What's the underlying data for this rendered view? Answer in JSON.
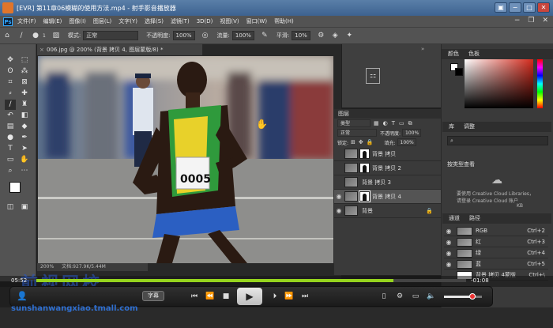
{
  "window": {
    "title": "[EVR] 第11章06模糊的使用方法.mp4 - 射手影音播放器"
  },
  "menubar": {
    "logo": "Ps",
    "items": [
      "文件(F)",
      "编辑(E)",
      "图像(I)",
      "图层(L)",
      "文字(Y)",
      "选择(S)",
      "滤镜(T)",
      "3D(D)",
      "视图(V)",
      "窗口(W)",
      "帮助(H)"
    ]
  },
  "optbar": {
    "brush_size": "1",
    "mode_label": "模式:",
    "mode_value": "正常",
    "opacity_label": "不透明度:",
    "opacity_value": "100%",
    "flow_label": "流量:",
    "flow_value": "100%",
    "smooth_label": "平滑:",
    "smooth_value": "10%"
  },
  "document": {
    "tab_title": "006.jpg @ 200% (背景 拷贝 4, 图层蒙版/8) *",
    "zoom": "200%",
    "docinfo": "文档:927.9K/5.44M"
  },
  "layers_panel": {
    "title": "图层",
    "kind_label": "类型",
    "blend_mode": "正常",
    "opacity_label": "不透明度:",
    "opacity_value": "100%",
    "lock_label": "锁定:",
    "fill_label": "填充:",
    "fill_value": "100%",
    "layers": [
      {
        "name": "背景 拷贝",
        "visible": false,
        "mask": true,
        "selected": false
      },
      {
        "name": "背景 拷贝 2",
        "visible": false,
        "mask": true,
        "selected": false
      },
      {
        "name": "背景 拷贝 3",
        "visible": false,
        "mask": false,
        "selected": false
      },
      {
        "name": "背景 拷贝 4",
        "visible": true,
        "mask": true,
        "selected": true
      },
      {
        "name": "背景",
        "visible": true,
        "mask": false,
        "selected": false
      }
    ]
  },
  "right_panels": {
    "color_tab": "颜色",
    "swatches_tab": "色板",
    "library_tab": "库",
    "adjust_tab": "调整",
    "library_select": "按类型查看",
    "cc_text": "要使用 Creative Cloud Libraries，",
    "cc_text2": "请登录 Creative Cloud 账户",
    "library_size": "KB",
    "channels_tab": "通道",
    "paths_tab": "路径",
    "channels": [
      {
        "name": "RGB",
        "shortcut": "Ctrl+2"
      },
      {
        "name": "红",
        "shortcut": "Ctrl+3"
      },
      {
        "name": "绿",
        "shortcut": "Ctrl+4"
      },
      {
        "name": "蓝",
        "shortcut": "Ctrl+5"
      },
      {
        "name": "背景 拷贝 4蒙版",
        "shortcut": "Ctrl+\\"
      }
    ]
  },
  "player": {
    "time_elapsed": "05:52",
    "time_remaining": "-01:08",
    "progress_fraction": 0.83,
    "volume_fraction": 0.75,
    "subtitle_label": "字幕",
    "watermark_cn": "前视网校",
    "watermark_url": "sunshanwangxiao.tmall.com"
  },
  "image": {
    "bib_number": "0005"
  },
  "colors": {
    "ps_gray": "#535353",
    "accent_green": "#96d41e",
    "title_blue": "#3d6290"
  }
}
